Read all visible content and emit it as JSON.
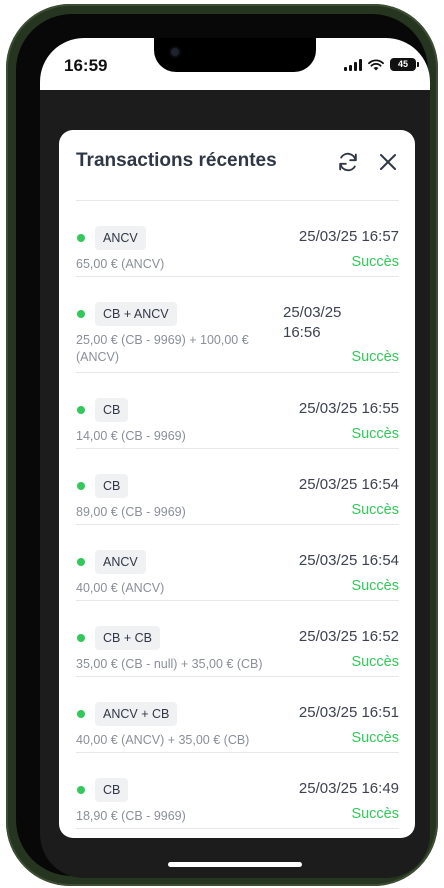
{
  "status_bar": {
    "time": "16:59",
    "battery": "45"
  },
  "modal": {
    "title": "Transactions récentes",
    "refresh_icon": "refresh-icon",
    "close_icon": "close-icon"
  },
  "colors": {
    "success": "#34c759",
    "title": "#2f3746",
    "muted": "#8a8f98"
  },
  "transactions": [
    {
      "type": "ANCV",
      "amount": "65,00 € (ANCV)",
      "date": "25/03/25 16:57",
      "status": "Succès"
    },
    {
      "type": "CB + ANCV",
      "amount": "25,00 € (CB - 9969) + 100,00 € (ANCV)",
      "date": "25/03/25 16:56",
      "status": "Succès"
    },
    {
      "type": "CB",
      "amount": "14,00 € (CB - 9969)",
      "date": "25/03/25 16:55",
      "status": "Succès"
    },
    {
      "type": "CB",
      "amount": "89,00 € (CB - 9969)",
      "date": "25/03/25 16:54",
      "status": "Succès"
    },
    {
      "type": "ANCV",
      "amount": "40,00 € (ANCV)",
      "date": "25/03/25 16:54",
      "status": "Succès"
    },
    {
      "type": "CB + CB",
      "amount": "35,00 € (CB - null) + 35,00 € (CB)",
      "date": "25/03/25 16:52",
      "status": "Succès"
    },
    {
      "type": "ANCV + CB",
      "amount": "40,00 € (ANCV) + 35,00 € (CB)",
      "date": "25/03/25 16:51",
      "status": "Succès"
    },
    {
      "type": "CB",
      "amount": "18,90 € (CB - 9969)",
      "date": "25/03/25 16:49",
      "status": "Succès"
    }
  ]
}
